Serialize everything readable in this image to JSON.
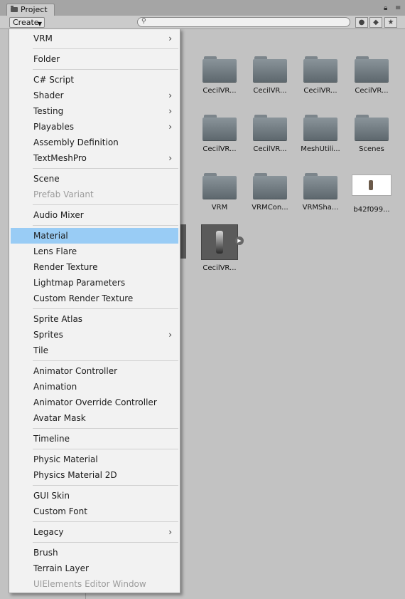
{
  "window": {
    "tab_title": "Project"
  },
  "toolbar": {
    "create_label": "Create",
    "search_placeholder": ""
  },
  "assets": [
    {
      "label": "CecilVR...",
      "kind": "folder"
    },
    {
      "label": "CecilVR...",
      "kind": "folder"
    },
    {
      "label": "CecilVR...",
      "kind": "folder"
    },
    {
      "label": "CecilVR...",
      "kind": "folder"
    },
    {
      "label": "CecilVR...",
      "kind": "folder"
    },
    {
      "label": "CecilVR...",
      "kind": "folder"
    },
    {
      "label": "MeshUtili...",
      "kind": "folder"
    },
    {
      "label": "Scenes",
      "kind": "folder"
    },
    {
      "label": "VRM",
      "kind": "folder"
    },
    {
      "label": "VRMCon...",
      "kind": "folder"
    },
    {
      "label": "VRMSha...",
      "kind": "folder"
    },
    {
      "label": "b42f099...",
      "kind": "texture"
    },
    {
      "label": "CecilVR...",
      "kind": "prefab"
    }
  ],
  "menu": {
    "items": [
      {
        "label": "VRM",
        "submenu": true
      },
      {
        "label": "Folder"
      },
      {
        "label": "C# Script"
      },
      {
        "label": "Shader",
        "submenu": true
      },
      {
        "label": "Testing",
        "submenu": true
      },
      {
        "label": "Playables",
        "submenu": true
      },
      {
        "label": "Assembly Definition"
      },
      {
        "label": "TextMeshPro",
        "submenu": true
      },
      {
        "label": "Scene"
      },
      {
        "label": "Prefab Variant",
        "disabled": true
      },
      {
        "label": "Audio Mixer"
      },
      {
        "label": "Material",
        "highlighted": true
      },
      {
        "label": "Lens Flare"
      },
      {
        "label": "Render Texture"
      },
      {
        "label": "Lightmap Parameters"
      },
      {
        "label": "Custom Render Texture"
      },
      {
        "label": "Sprite Atlas"
      },
      {
        "label": "Sprites",
        "submenu": true
      },
      {
        "label": "Tile"
      },
      {
        "label": "Animator Controller"
      },
      {
        "label": "Animation"
      },
      {
        "label": "Animator Override Controller"
      },
      {
        "label": "Avatar Mask"
      },
      {
        "label": "Timeline"
      },
      {
        "label": "Physic Material"
      },
      {
        "label": "Physics Material 2D"
      },
      {
        "label": "GUI Skin"
      },
      {
        "label": "Custom Font"
      },
      {
        "label": "Legacy",
        "submenu": true
      },
      {
        "label": "Brush"
      },
      {
        "label": "Terrain Layer"
      },
      {
        "label": "UIElements Editor Window",
        "disabled": true
      }
    ],
    "submenu_arrow": "›"
  },
  "colors": {
    "highlight": "#99ccf5",
    "folder": "#6b757b",
    "panel_bg": "#c2c2c2",
    "menu_bg": "#f2f2f2"
  }
}
